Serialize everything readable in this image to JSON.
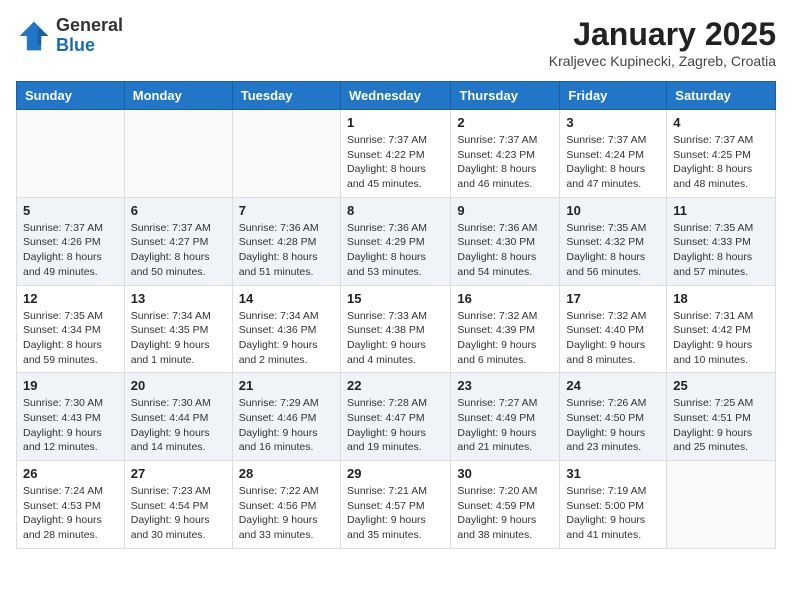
{
  "header": {
    "logo_general": "General",
    "logo_blue": "Blue",
    "month_title": "January 2025",
    "subtitle": "Kraljevec Kupinecki, Zagreb, Croatia"
  },
  "weekdays": [
    "Sunday",
    "Monday",
    "Tuesday",
    "Wednesday",
    "Thursday",
    "Friday",
    "Saturday"
  ],
  "weeks": [
    [
      {
        "day": "",
        "info": ""
      },
      {
        "day": "",
        "info": ""
      },
      {
        "day": "",
        "info": ""
      },
      {
        "day": "1",
        "info": "Sunrise: 7:37 AM\nSunset: 4:22 PM\nDaylight: 8 hours\nand 45 minutes."
      },
      {
        "day": "2",
        "info": "Sunrise: 7:37 AM\nSunset: 4:23 PM\nDaylight: 8 hours\nand 46 minutes."
      },
      {
        "day": "3",
        "info": "Sunrise: 7:37 AM\nSunset: 4:24 PM\nDaylight: 8 hours\nand 47 minutes."
      },
      {
        "day": "4",
        "info": "Sunrise: 7:37 AM\nSunset: 4:25 PM\nDaylight: 8 hours\nand 48 minutes."
      }
    ],
    [
      {
        "day": "5",
        "info": "Sunrise: 7:37 AM\nSunset: 4:26 PM\nDaylight: 8 hours\nand 49 minutes."
      },
      {
        "day": "6",
        "info": "Sunrise: 7:37 AM\nSunset: 4:27 PM\nDaylight: 8 hours\nand 50 minutes."
      },
      {
        "day": "7",
        "info": "Sunrise: 7:36 AM\nSunset: 4:28 PM\nDaylight: 8 hours\nand 51 minutes."
      },
      {
        "day": "8",
        "info": "Sunrise: 7:36 AM\nSunset: 4:29 PM\nDaylight: 8 hours\nand 53 minutes."
      },
      {
        "day": "9",
        "info": "Sunrise: 7:36 AM\nSunset: 4:30 PM\nDaylight: 8 hours\nand 54 minutes."
      },
      {
        "day": "10",
        "info": "Sunrise: 7:35 AM\nSunset: 4:32 PM\nDaylight: 8 hours\nand 56 minutes."
      },
      {
        "day": "11",
        "info": "Sunrise: 7:35 AM\nSunset: 4:33 PM\nDaylight: 8 hours\nand 57 minutes."
      }
    ],
    [
      {
        "day": "12",
        "info": "Sunrise: 7:35 AM\nSunset: 4:34 PM\nDaylight: 8 hours\nand 59 minutes."
      },
      {
        "day": "13",
        "info": "Sunrise: 7:34 AM\nSunset: 4:35 PM\nDaylight: 9 hours\nand 1 minute."
      },
      {
        "day": "14",
        "info": "Sunrise: 7:34 AM\nSunset: 4:36 PM\nDaylight: 9 hours\nand 2 minutes."
      },
      {
        "day": "15",
        "info": "Sunrise: 7:33 AM\nSunset: 4:38 PM\nDaylight: 9 hours\nand 4 minutes."
      },
      {
        "day": "16",
        "info": "Sunrise: 7:32 AM\nSunset: 4:39 PM\nDaylight: 9 hours\nand 6 minutes."
      },
      {
        "day": "17",
        "info": "Sunrise: 7:32 AM\nSunset: 4:40 PM\nDaylight: 9 hours\nand 8 minutes."
      },
      {
        "day": "18",
        "info": "Sunrise: 7:31 AM\nSunset: 4:42 PM\nDaylight: 9 hours\nand 10 minutes."
      }
    ],
    [
      {
        "day": "19",
        "info": "Sunrise: 7:30 AM\nSunset: 4:43 PM\nDaylight: 9 hours\nand 12 minutes."
      },
      {
        "day": "20",
        "info": "Sunrise: 7:30 AM\nSunset: 4:44 PM\nDaylight: 9 hours\nand 14 minutes."
      },
      {
        "day": "21",
        "info": "Sunrise: 7:29 AM\nSunset: 4:46 PM\nDaylight: 9 hours\nand 16 minutes."
      },
      {
        "day": "22",
        "info": "Sunrise: 7:28 AM\nSunset: 4:47 PM\nDaylight: 9 hours\nand 19 minutes."
      },
      {
        "day": "23",
        "info": "Sunrise: 7:27 AM\nSunset: 4:49 PM\nDaylight: 9 hours\nand 21 minutes."
      },
      {
        "day": "24",
        "info": "Sunrise: 7:26 AM\nSunset: 4:50 PM\nDaylight: 9 hours\nand 23 minutes."
      },
      {
        "day": "25",
        "info": "Sunrise: 7:25 AM\nSunset: 4:51 PM\nDaylight: 9 hours\nand 25 minutes."
      }
    ],
    [
      {
        "day": "26",
        "info": "Sunrise: 7:24 AM\nSunset: 4:53 PM\nDaylight: 9 hours\nand 28 minutes."
      },
      {
        "day": "27",
        "info": "Sunrise: 7:23 AM\nSunset: 4:54 PM\nDaylight: 9 hours\nand 30 minutes."
      },
      {
        "day": "28",
        "info": "Sunrise: 7:22 AM\nSunset: 4:56 PM\nDaylight: 9 hours\nand 33 minutes."
      },
      {
        "day": "29",
        "info": "Sunrise: 7:21 AM\nSunset: 4:57 PM\nDaylight: 9 hours\nand 35 minutes."
      },
      {
        "day": "30",
        "info": "Sunrise: 7:20 AM\nSunset: 4:59 PM\nDaylight: 9 hours\nand 38 minutes."
      },
      {
        "day": "31",
        "info": "Sunrise: 7:19 AM\nSunset: 5:00 PM\nDaylight: 9 hours\nand 41 minutes."
      },
      {
        "day": "",
        "info": ""
      }
    ]
  ]
}
